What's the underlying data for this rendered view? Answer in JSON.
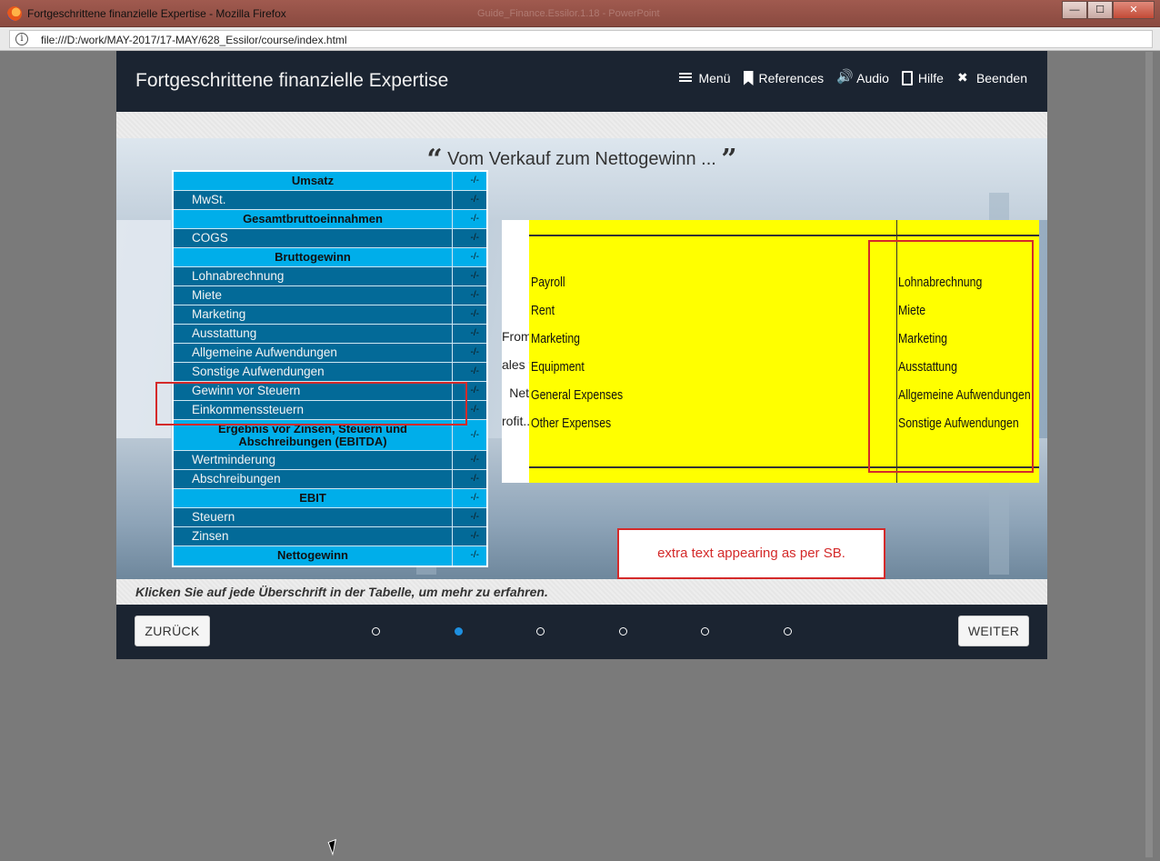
{
  "window": {
    "title": "Fortgeschrittene finanzielle Expertise - Mozilla Firefox",
    "ghost_title": "Guide_Finance.Essilor.1.18 - PowerPoint",
    "minimize": "—",
    "maximize": "☐",
    "close": "✕"
  },
  "address": {
    "url": "file:///D:/work/MAY-2017/17-MAY/628_Essilor/course/index.html",
    "info_glyph": "i"
  },
  "course": {
    "title": "Fortgeschrittene finanzielle Expertise",
    "nav": [
      {
        "label": "Menü",
        "icon": "menu-icon"
      },
      {
        "label": "References",
        "icon": "bookmark-icon"
      },
      {
        "label": "Audio",
        "icon": "audio-icon"
      },
      {
        "label": "Hilfe",
        "icon": "help-icon"
      },
      {
        "label": "Beenden",
        "icon": "close-icon"
      }
    ]
  },
  "slide": {
    "quote_open": "“",
    "heading": "Vom Verkauf zum Nettogewinn ...",
    "quote_close": "”",
    "table": [
      {
        "label": "Umsatz",
        "value": "-/-",
        "type": "head"
      },
      {
        "label": "MwSt.",
        "value": "-/-",
        "type": "sub"
      },
      {
        "label": "Gesamtbruttoeinnahmen",
        "value": "-/-",
        "type": "head"
      },
      {
        "label": "COGS",
        "value": "-/-",
        "type": "sub"
      },
      {
        "label": "Bruttogewinn",
        "value": "-/-",
        "type": "head"
      },
      {
        "label": "Lohnabrechnung",
        "value": "-/-",
        "type": "sub"
      },
      {
        "label": "Miete",
        "value": "-/-",
        "type": "sub"
      },
      {
        "label": "Marketing",
        "value": "-/-",
        "type": "sub"
      },
      {
        "label": "Ausstattung",
        "value": "-/-",
        "type": "sub"
      },
      {
        "label": "Allgemeine Aufwendungen",
        "value": "-/-",
        "type": "sub"
      },
      {
        "label": "Sonstige Aufwendungen",
        "value": "-/-",
        "type": "sub"
      },
      {
        "label": "Gewinn vor Steuern",
        "value": "-/-",
        "type": "sub"
      },
      {
        "label": "Einkommenssteuern",
        "value": "-/-",
        "type": "sub"
      },
      {
        "label": "Ergebnis vor Zinsen, Steuern und Abschreibungen (EBITDA)",
        "value": "-/-",
        "type": "head-tall"
      },
      {
        "label": "Wertminderung",
        "value": "-/-",
        "type": "sub"
      },
      {
        "label": "Abschreibungen",
        "value": "-/-",
        "type": "sub"
      },
      {
        "label": "EBIT",
        "value": "-/-",
        "type": "head"
      },
      {
        "label": "Steuern",
        "value": "-/-",
        "type": "sub"
      },
      {
        "label": "Zinsen",
        "value": "-/-",
        "type": "sub"
      },
      {
        "label": "Nettogewinn",
        "value": "-/-",
        "type": "head"
      }
    ],
    "embedded": {
      "side_labels": [
        "From",
        "ales to",
        "Net",
        "rofit..."
      ],
      "english": [
        "Payroll",
        "Rent",
        "Marketing",
        "Equipment",
        "General Expenses",
        "Other Expenses"
      ],
      "german": [
        "Lohnabrechnung",
        "Miete",
        "Marketing",
        "Ausstattung",
        "Allgemeine Aufwendungen",
        "Sonstige Aufwendungen"
      ]
    },
    "note": "extra text appearing as per SB.",
    "instruction": "Klicken Sie auf jede Überschrift in der Tabelle, um mehr zu erfahren."
  },
  "footer": {
    "back_label": "ZURÜCK",
    "next_label": "WEITER",
    "pages_total": 6,
    "active_page": 2
  }
}
